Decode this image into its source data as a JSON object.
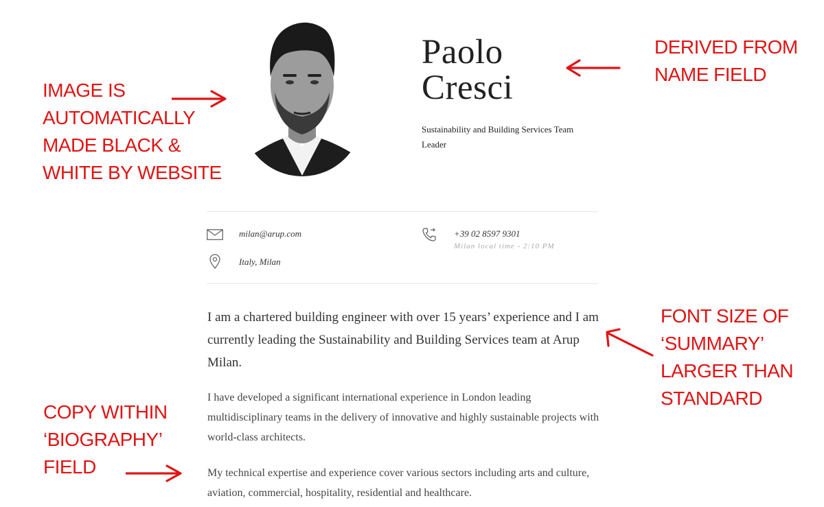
{
  "profile": {
    "name_first": "Paolo",
    "name_last": "Cresci",
    "role": "Sustainability and Building Services Team Leader",
    "photo_icon": "portrait-photo"
  },
  "contact": {
    "email": "milan@arup.com",
    "phone": "+39 02 8597 9301",
    "local_time": "Milan local time - 2:10 PM",
    "location": "Italy, Milan",
    "icons": [
      "mail-icon",
      "phone-icon",
      "location-pin-icon"
    ]
  },
  "summary": "I am a chartered building engineer with over 15 years’ experience and I am currently leading the Sustainability and Building Services team at Arup Milan.",
  "biography": [
    "I have developed a significant international experience in London leading multidisciplinary teams in the delivery of innovative and highly sustainable projects with world-class architects.",
    "My technical expertise and experience cover various sectors including arts and culture, aviation, commercial, hospitality, residential and healthcare."
  ],
  "annotations": {
    "image_note": [
      "IMAGE IS",
      "AUTOMATICALLY",
      "MADE BLACK &",
      "WHITE BY WEBSITE"
    ],
    "name_note": [
      "DERIVED FROM",
      "NAME FIELD"
    ],
    "summary_note": [
      "FONT SIZE OF",
      "‘SUMMARY’",
      "LARGER THAN",
      "STANDARD"
    ],
    "bio_note": [
      "COPY WITHIN",
      "‘BIOGRAPHY’",
      "FIELD"
    ],
    "color": "#e01414"
  }
}
